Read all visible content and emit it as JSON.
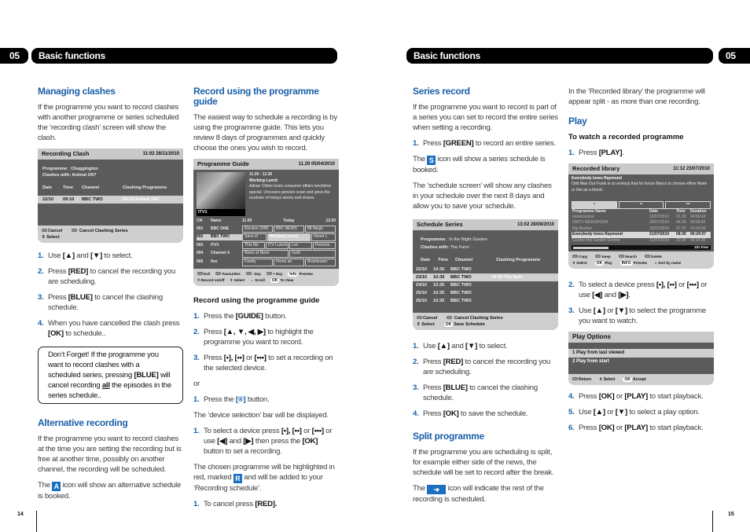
{
  "header": {
    "chapter_number": "05",
    "chapter_title": "Basic functions"
  },
  "footer": {
    "left_page": "14",
    "right_page": "15"
  },
  "managing_clashes": {
    "title": "Managing clashes",
    "intro": "If the programme you want to record clashes with another programme or series scheduled the ‘recording clash’ screen will show the clash.",
    "screen": {
      "title": "Recording Clash",
      "datetime": "11:02  28/11/2010",
      "programme_label": "Programme:",
      "programme_value": "Chuggington",
      "clashes_label": "Clashes with:",
      "clashes_value": "Animal 24/7",
      "columns": [
        "Date",
        "Time",
        "Channel",
        "Clashing Programme"
      ],
      "rows": [
        [
          "22/10",
          "09:10",
          "BBC TWO",
          "09:15 Animal 24/7"
        ]
      ],
      "footer": [
        "Cancel",
        "Cancel Clashing Series",
        "Select"
      ]
    },
    "steps": [
      {
        "n": "1.",
        "pre": "Use ",
        "key": "[▲]",
        "mid": " and ",
        "key2": "[▼]",
        "post": " to select."
      },
      {
        "n": "2.",
        "pre": "Press ",
        "key": "[RED]",
        "post": " to cancel the recording you are scheduling."
      },
      {
        "n": "3.",
        "pre": "Press ",
        "key": "[BLUE]",
        "post": " to cancel the clashing schedule."
      },
      {
        "n": "4.",
        "pre": "When you have cancelled the clash press ",
        "key": "[OK]",
        "post": " to schedule.."
      }
    ],
    "note": {
      "pre": "Don’t Forget! If the programme you want to record clashes with a scheduled series, pressing ",
      "key": "[BLUE]",
      "mid": " will cancel recording ",
      "emph": "all",
      "post": " the episodes in the series schedule.."
    }
  },
  "alternative_recording": {
    "title": "Alternative recording",
    "text": "If the programme you want to record clashes at the time you are setting the recording but is free at another time, possibly on another channel, the recording will be scheduled.",
    "icon_pre": "The ",
    "icon_letter": "A",
    "icon_post": " icon will show an alternative schedule is booked."
  },
  "programme_guide": {
    "title": "Record using the programme guide",
    "intro": "The easiest way to schedule a recording is by using the programme guide. This lets you review 8 days of programmes and quickly choose the ones you wish to record.",
    "screen": {
      "title": "Programme Guide",
      "datetime": "11.20 05/04/2010",
      "channel_logo": "ITV1",
      "prog_time": "11.30 - 12.30",
      "prog_title": "Working Lunch",
      "prog_desc": "Adrian Chiles hosts consumer affairs lunchtime special. Uncovers pension scam and gives the rundown of todays stocks and shares.",
      "col_cn": "CN",
      "col_name": "Name",
      "time_start": "11.00",
      "time_day": "Today",
      "time_end": "13.00",
      "channels": [
        {
          "cn": "001",
          "name": "BBC ONE",
          "progs": [
            "Election 2005",
            "BBC NEWS",
            "88 Neigh"
          ]
        },
        {
          "cn": "002",
          "name": "BBC TWO",
          "progs": [
            "Sans of",
            "Working Lunch",
            "Never L"
          ]
        },
        {
          "cn": "003",
          "name": "ITV1",
          "progs": [
            "This Mo",
            "ITV Luncht",
            "Lon",
            "Persove"
          ]
        },
        {
          "cn": "004",
          "name": "Channel 4",
          "progs": [
            "News at Noon",
            "Gold"
          ]
        },
        {
          "cn": "005",
          "name": "five",
          "progs": [
            "Family",
            "Home an",
            "Brainteaser"
          ]
        }
      ],
      "footer_row1": [
        "Exit",
        "Favourites",
        "- Day",
        "+ Day",
        "Preview"
      ],
      "footer_row2": [
        "Record on/off",
        "Select",
        "Scroll",
        "To View"
      ],
      "info_label": "Info",
      "ok_label": "OK"
    },
    "subtitle": "Record using the programme guide",
    "steps": [
      {
        "n": "1.",
        "pre": "Press the ",
        "key": "[GUIDE]",
        "post": " button."
      },
      {
        "n": "2.",
        "pre": "Press ",
        "key": "[▲, ▼, ◀, ▶]",
        "post": " to highlight the programme you want to record."
      },
      {
        "n": "3.",
        "pre": "Press ",
        "key": "[•], [••]",
        "mid": " or ",
        "key2": "[•••]",
        "post": " to set a recording on the selected device."
      }
    ],
    "or": "or",
    "steps2": [
      {
        "n": "1.",
        "pre": "Press the ",
        "key": "[®]",
        "post": " button."
      }
    ],
    "device_bar_text": "The ‘device selection’ bar will be displayed.",
    "steps3": [
      {
        "n": "1.",
        "pre": "To select a device press ",
        "key": "[•], [••]",
        "mid": " or ",
        "key2": "[•••]",
        "mid2": " or use ",
        "key3": "[◀]",
        "mid3": " and ",
        "key4": "[▶]",
        "mid4": " then press the ",
        "key5": "[OK]",
        "post": " button to set a recording."
      }
    ],
    "highlight_pre": "The chosen programme will be highlighted in red, marked ",
    "highlight_icon": "R",
    "highlight_post": " and will be added to your ‘Recording schedule’.",
    "steps4": [
      {
        "n": "1.",
        "pre": "To cancel press ",
        "key": "[RED].",
        "post": ""
      }
    ]
  },
  "series_record": {
    "title": "Series record",
    "intro": "If the programme you want to record is part of a series you can set to record the entire series when setting a recording.",
    "steps": [
      {
        "n": "1.",
        "pre": "Press ",
        "key": "[GREEN]",
        "post": " to record an entire series."
      }
    ],
    "icon_pre": "The ",
    "icon_letter": "S",
    "icon_post": " icon will show a series schedule is booked.",
    "schedule_text": "The ‘schedule screen’ will show any clashes in your schedule over the next 8 days and allow you to save your schedule.",
    "screen": {
      "title": "Schedule Series",
      "datetime": "13:02  28/08/2010",
      "programme_label": "Programme:",
      "programme_value": "In the Night Garden",
      "clashes_label": "Clashes with:",
      "clashes_value": "The Farm",
      "columns": [
        "Date",
        "Time",
        "Channel",
        "Clashing Programme"
      ],
      "rows": [
        [
          "22/10",
          "10:35",
          "BBC TWO",
          ""
        ],
        [
          "23/10",
          "10:35",
          "BBC TWO",
          "10:30 The farm"
        ],
        [
          "24/10",
          "10:35",
          "BBC TWO",
          ""
        ],
        [
          "25/10",
          "10:35",
          "BBC TWO",
          ""
        ],
        [
          "26/10",
          "10:35",
          "BBC TWO",
          ""
        ]
      ],
      "footer": [
        "Cancel",
        "Cancel Clashing Series",
        "Select",
        "Save Schedule"
      ],
      "ok_label": "OK"
    },
    "steps2": [
      {
        "n": "1.",
        "pre": "Use ",
        "key": "[▲]",
        "mid": " and ",
        "key2": "[▼]",
        "post": " to select."
      },
      {
        "n": "2.",
        "pre": "Press ",
        "key": "[RED]",
        "post": " to cancel the recording you are scheduling."
      },
      {
        "n": "3.",
        "pre": "Press ",
        "key": "[BLUE]",
        "post": " to cancel the clashing schedule."
      },
      {
        "n": "4.",
        "pre": "Press ",
        "key": "[OK]",
        "post": " to save the schedule."
      }
    ]
  },
  "split_programme": {
    "title": "Split programme",
    "text": "If the programme you are scheduling is split, for example either side of the news, the schedule will be set to record after the break.",
    "icon_pre": "The ",
    "icon_post": " icon will indicate the rest of the recording is scheduled.",
    "library_text": "In the ‘Recorded library’ the programme will appear split - as more than one recording."
  },
  "play": {
    "title": "Play",
    "subtitle": "To watch a recorded programme",
    "steps": [
      {
        "n": "1.",
        "pre": "Press ",
        "key": "[PLAY]",
        "post": "."
      }
    ],
    "library_screen": {
      "title": "Recorded library",
      "datetime": "11:12 23/07/2010",
      "selected_title": "Everybody loves Raymond",
      "selected_desc": "Odd Man Out Frank is so envious that he forces Marco to choose either Marie or him as a friend.",
      "tabs": [
        "•",
        "••",
        "•••"
      ],
      "columns": [
        "Programme Name",
        "Date",
        "Time",
        "Duration"
      ],
      "rows": [
        [
          "Italianissimo",
          "19/07/2010",
          "01.30",
          "04:59:43"
        ],
        [
          "GMTV NEWSHOUR",
          "20/07/2010",
          "06:30",
          "00:59:55"
        ],
        [
          "Big Brother",
          "20/07/2010",
          "07:30",
          "01:04:55"
        ],
        [
          "Everybody loves Raymond",
          "21/07/2010",
          "08:30",
          "00:24:57"
        ],
        [
          "Gordon the Garden Gnome",
          "21/07/2010",
          "10:30",
          "00:14:30"
        ]
      ],
      "selected_row": 3,
      "disk_used_fraction": 0.28,
      "free_label": "1hr Free",
      "footer_row1": [
        "Copy",
        "Keep",
        "Search",
        "Delete"
      ],
      "footer_row2": [
        "Select",
        "Play",
        "Preview",
        "Sort by name"
      ],
      "ok_label": "OK",
      "info_label": "INFO"
    },
    "steps2": [
      {
        "n": "2.",
        "pre": "To select a device press ",
        "key": "[•], [••]",
        "mid": " or ",
        "key2": "[•••]",
        "mid2": " or use ",
        "key3": "[◀]",
        "mid3": " and ",
        "key4": "[▶]",
        "post": "."
      },
      {
        "n": "3.",
        "pre": "Use ",
        "key": "[▲]",
        "mid": " or ",
        "key2": "[▼]",
        "post": " to select the programme you want to watch."
      }
    ],
    "options_screen": {
      "title": "Play Options",
      "options": [
        "1  Play from last viewed",
        "2  Play from start"
      ],
      "selected": 0,
      "footer": [
        "Return",
        "Select",
        "Accept"
      ],
      "ok_label": "OK"
    },
    "steps3": [
      {
        "n": "4.",
        "pre": "Press ",
        "key": "[OK]",
        "mid": " or ",
        "key2": "[PLAY]",
        "post": " to start playback."
      },
      {
        "n": "5.",
        "pre": "Use ",
        "key": "[▲]",
        "mid": " or ",
        "key2": "[▼]",
        "post": " to select a play option."
      },
      {
        "n": "6.",
        "pre": "Press ",
        "key": "[OK]",
        "mid": " or ",
        "key2": "[PLAY]",
        "post": " to start playback."
      }
    ]
  }
}
